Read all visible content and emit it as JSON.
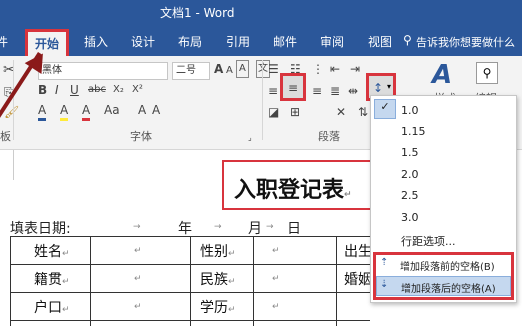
{
  "window": {
    "title": "文档1 - Word"
  },
  "tabs": [
    {
      "label": "件"
    },
    {
      "label": "开始"
    },
    {
      "label": "插入"
    },
    {
      "label": "设计"
    },
    {
      "label": "布局"
    },
    {
      "label": "引用"
    },
    {
      "label": "邮件"
    },
    {
      "label": "审阅"
    },
    {
      "label": "视图"
    }
  ],
  "tell_me": "告诉我你想要做什么",
  "font": {
    "name": "黑体",
    "size": "二号",
    "group_label": "字体",
    "grow_label": "A",
    "shrink_label": "A",
    "clear_label": "A",
    "wen_label": "文",
    "bold": "B",
    "italic": "I",
    "underline": "U",
    "strike": "abc",
    "sub": "X₂",
    "sup": "X²",
    "highlight": "A",
    "font_color": "A",
    "case": "Aa",
    "char_a1": "A",
    "char_a2": "A",
    "char_a3": "A"
  },
  "paragraph": {
    "group_label": "段落"
  },
  "styles": {
    "label": "样式"
  },
  "edit": {
    "label": "编辑"
  },
  "clipboard": {
    "label": "板"
  },
  "document": {
    "heading": "入职登记表",
    "date_line": "填表日期:",
    "year": "年",
    "month": "月",
    "day": "日",
    "rows": [
      {
        "col1": "姓名",
        "col3": "性别",
        "col5": "出生"
      },
      {
        "col1": "籍贯",
        "col3": "民族",
        "col5": "婚姻"
      },
      {
        "col1": "户口",
        "col3": "学历",
        "col5": ""
      }
    ]
  },
  "line_spacing_menu": {
    "options": [
      {
        "label": "1.0",
        "checked": true
      },
      {
        "label": "1.15",
        "checked": false
      },
      {
        "label": "1.5",
        "checked": false
      },
      {
        "label": "2.0",
        "checked": false
      },
      {
        "label": "2.5",
        "checked": false
      },
      {
        "label": "3.0",
        "checked": false
      }
    ],
    "options_link": "行距选项...",
    "add_before": "增加段落前的空格(B)",
    "add_after": "增加段落后的空格(A)"
  },
  "colors": {
    "accent": "#2b579a",
    "highlight_box": "#d8343d",
    "arrow": "#8b1a1a"
  }
}
